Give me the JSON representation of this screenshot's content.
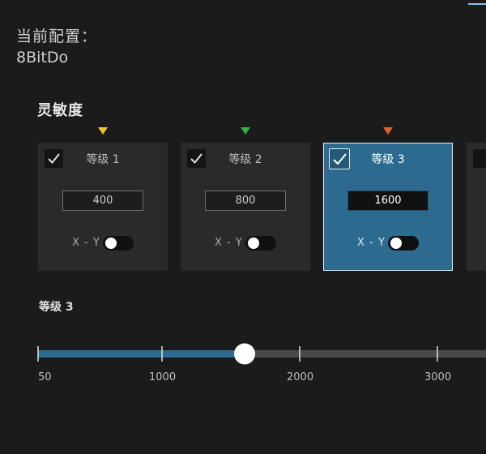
{
  "header": {
    "config_title": "当前配置：",
    "config_name": "8BitDo"
  },
  "sensitivity": {
    "title": "灵敏度",
    "levels": [
      {
        "label": "等级 1",
        "value": "400",
        "xy_label": "X - Y",
        "checked": true,
        "marker_color": "#e7c62f"
      },
      {
        "label": "等级 2",
        "value": "800",
        "xy_label": "X - Y",
        "checked": true,
        "marker_color": "#2fb24a"
      },
      {
        "label": "等级 3",
        "value": "1600",
        "xy_label": "X - Y",
        "checked": true,
        "marker_color": "#e0622f",
        "active": true
      }
    ]
  },
  "slider": {
    "title": "等级 3",
    "value": 1600,
    "ticks": [
      "50",
      "1000",
      "2000",
      "3000"
    ],
    "fill_color": "#2c6b8f"
  }
}
